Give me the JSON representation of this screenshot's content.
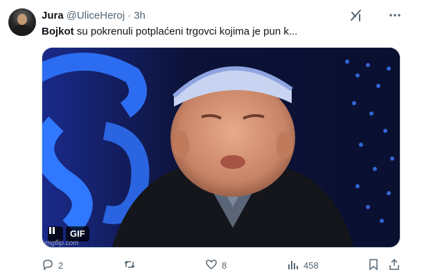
{
  "author": {
    "name": "Jura",
    "handle": "@UliceHeroj",
    "separator": "·",
    "time": "3h"
  },
  "tweet": {
    "bold_text": "Bojkot",
    "text": " su pokrenuli potplaćeni trgovci kojima je pun k..."
  },
  "media": {
    "type": "GIF",
    "badge_label": "GIF",
    "watermark": "imgflip.com"
  },
  "actions": {
    "replies": "2",
    "retweets": "",
    "likes": "8",
    "views": "458"
  },
  "icons": {
    "grok": "grok-icon",
    "more": "more-icon",
    "reply": "reply-icon",
    "retweet": "retweet-icon",
    "like": "heart-icon",
    "views": "views-icon",
    "bookmark": "bookmark-icon",
    "share": "share-icon",
    "pause": "pause-icon"
  },
  "colors": {
    "text": "#0f1419",
    "secondary": "#536471",
    "border": "#cfd9de"
  }
}
